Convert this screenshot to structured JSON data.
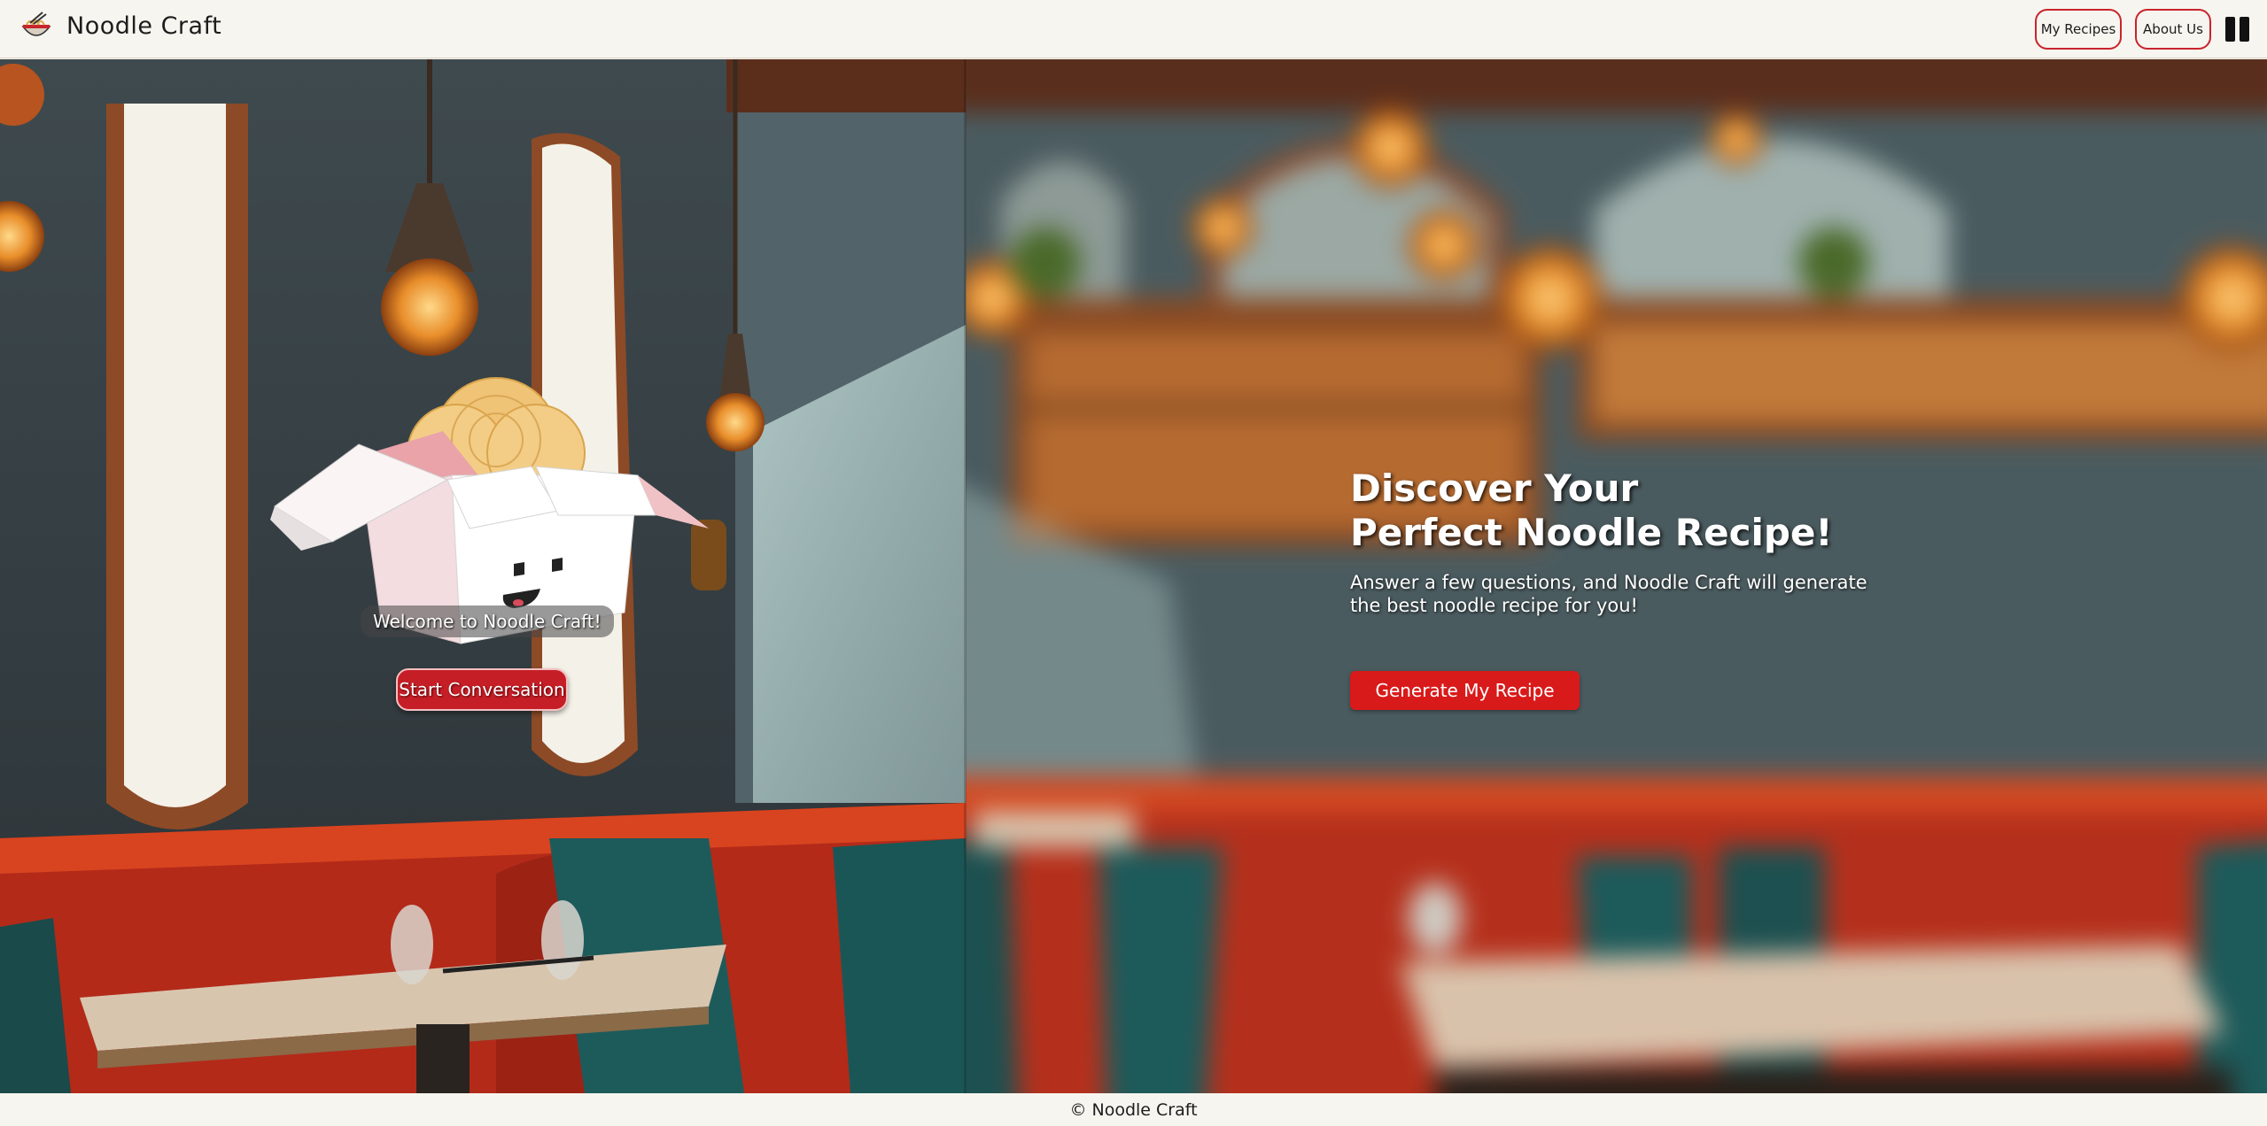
{
  "header": {
    "brand": "Noodle Craft",
    "nav": [
      {
        "label": "My Recipes"
      },
      {
        "label": "About Us"
      }
    ]
  },
  "left": {
    "welcome": "Welcome to Noodle Craft!",
    "start_button": "Start Conversation"
  },
  "right": {
    "title_line1": "Discover Your",
    "title_line2": "Perfect Noodle Recipe!",
    "subtitle": "Answer a few questions, and Noodle Craft will generate the best noodle recipe for you!",
    "generate_button": "Generate My Recipe"
  },
  "footer": {
    "text": "© Noodle Craft"
  },
  "colors": {
    "accent_red": "#d91a1a",
    "header_bg": "#f7f5ef"
  },
  "icons": [
    "noodle-bowl-logo-icon",
    "menu-icon",
    "noodle-box-mascot-icon"
  ]
}
